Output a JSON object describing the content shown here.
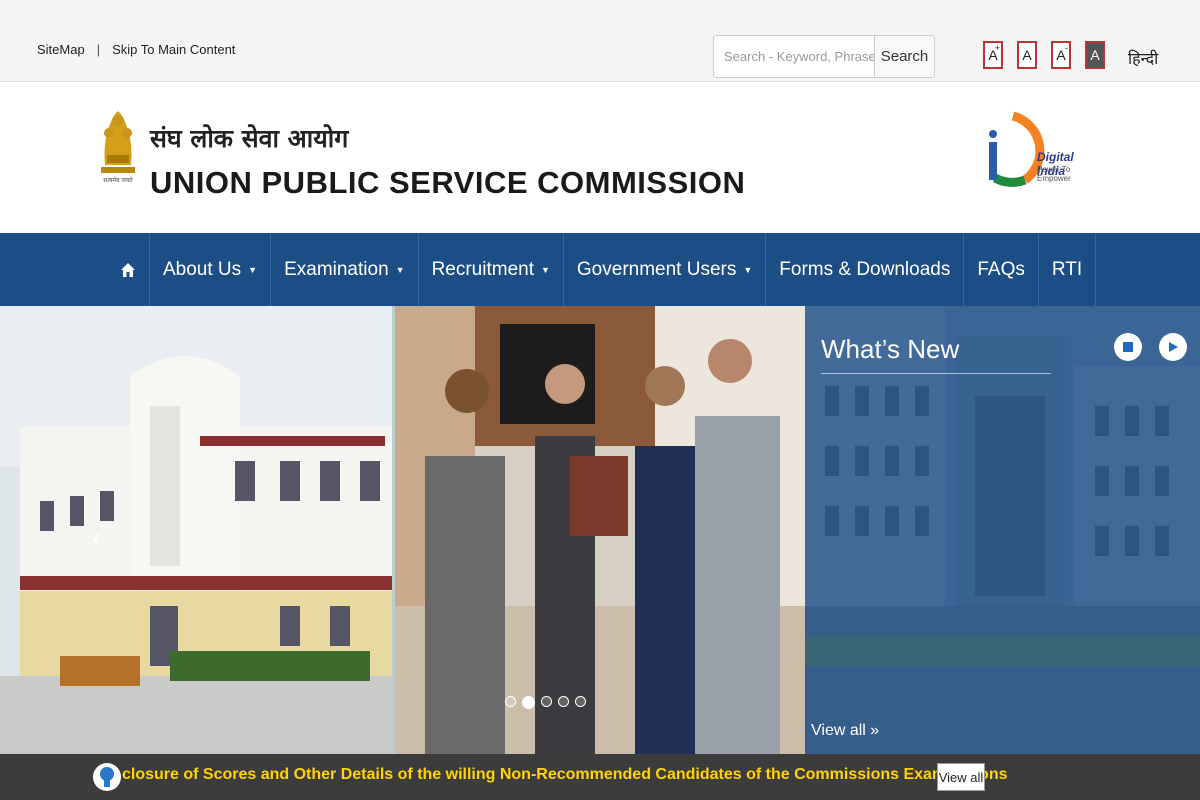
{
  "topbar": {
    "sitemap": "SiteMap",
    "separator": "|",
    "skip": "Skip To Main Content",
    "search_placeholder": "Search - Keyword, Phrase",
    "search_button": "Search",
    "font_increase": "A",
    "font_normal": "A",
    "font_decrease": "A",
    "font_contrast": "A",
    "font_increase_sup": "+",
    "font_decrease_sup": "-",
    "language": "हिन्दी"
  },
  "header": {
    "title_hindi": "संघ लोक सेवा आयोग",
    "title_english": "UNION PUBLIC SERVICE COMMISSION",
    "emblem_motto": "सत्यमेव जयते",
    "digital_india": "Digital India",
    "digital_tagline": "Power To Empower"
  },
  "nav": {
    "items": [
      {
        "label": "About Us",
        "dropdown": true
      },
      {
        "label": "Examination",
        "dropdown": true
      },
      {
        "label": "Recruitment",
        "dropdown": true
      },
      {
        "label": "Government Users",
        "dropdown": true
      },
      {
        "label": "Forms & Downloads",
        "dropdown": false
      },
      {
        "label": "FAQs",
        "dropdown": false
      },
      {
        "label": "RTI",
        "dropdown": false
      }
    ]
  },
  "slider": {
    "dot_count": 5,
    "active_dot": 2
  },
  "whats_new": {
    "title": "What’s New",
    "view_all": "View all »"
  },
  "ticker": {
    "message": "closure of Scores and Other Details of the willing Non-Recommended Candidates of the Commissions Examinations",
    "button": "View all"
  },
  "colors": {
    "nav_bg": "#1c4e85",
    "ticker_bg": "#3c3c3c",
    "ticker_text": "#ffd400",
    "font_btn_border": "#bb3333"
  }
}
